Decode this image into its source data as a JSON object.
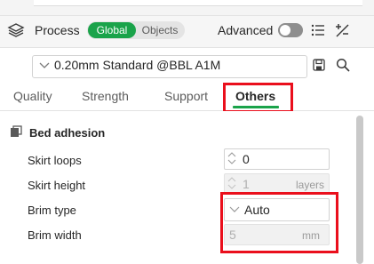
{
  "header": {
    "process_label": "Process",
    "scope_global": "Global",
    "scope_objects": "Objects",
    "advanced_label": "Advanced",
    "advanced_on": false
  },
  "preset": {
    "selected": "0.20mm Standard @BBL A1M"
  },
  "tabs": [
    {
      "label": "Quality",
      "active": false
    },
    {
      "label": "Strength",
      "active": false
    },
    {
      "label": "Support",
      "active": false
    },
    {
      "label": "Others",
      "active": true
    }
  ],
  "section": {
    "title": "Bed adhesion",
    "rows": [
      {
        "label": "Skirt loops",
        "value": "0",
        "unit": "",
        "enabled": true
      },
      {
        "label": "Skirt height",
        "value": "1",
        "unit": "layers",
        "enabled": false
      },
      {
        "label": "Brim type",
        "value": "Auto",
        "unit": "",
        "enabled": true
      },
      {
        "label": "Brim width",
        "value": "5",
        "unit": "mm",
        "enabled": false
      }
    ]
  },
  "colors": {
    "accent": "#1aa34a",
    "highlight": "#ea0f1c"
  },
  "icons": [
    "process-icon",
    "list-icon",
    "compare-icon",
    "chevron-down-icon",
    "save-icon",
    "search-icon",
    "bed-adhesion-icon",
    "spin-arrows-icon"
  ]
}
